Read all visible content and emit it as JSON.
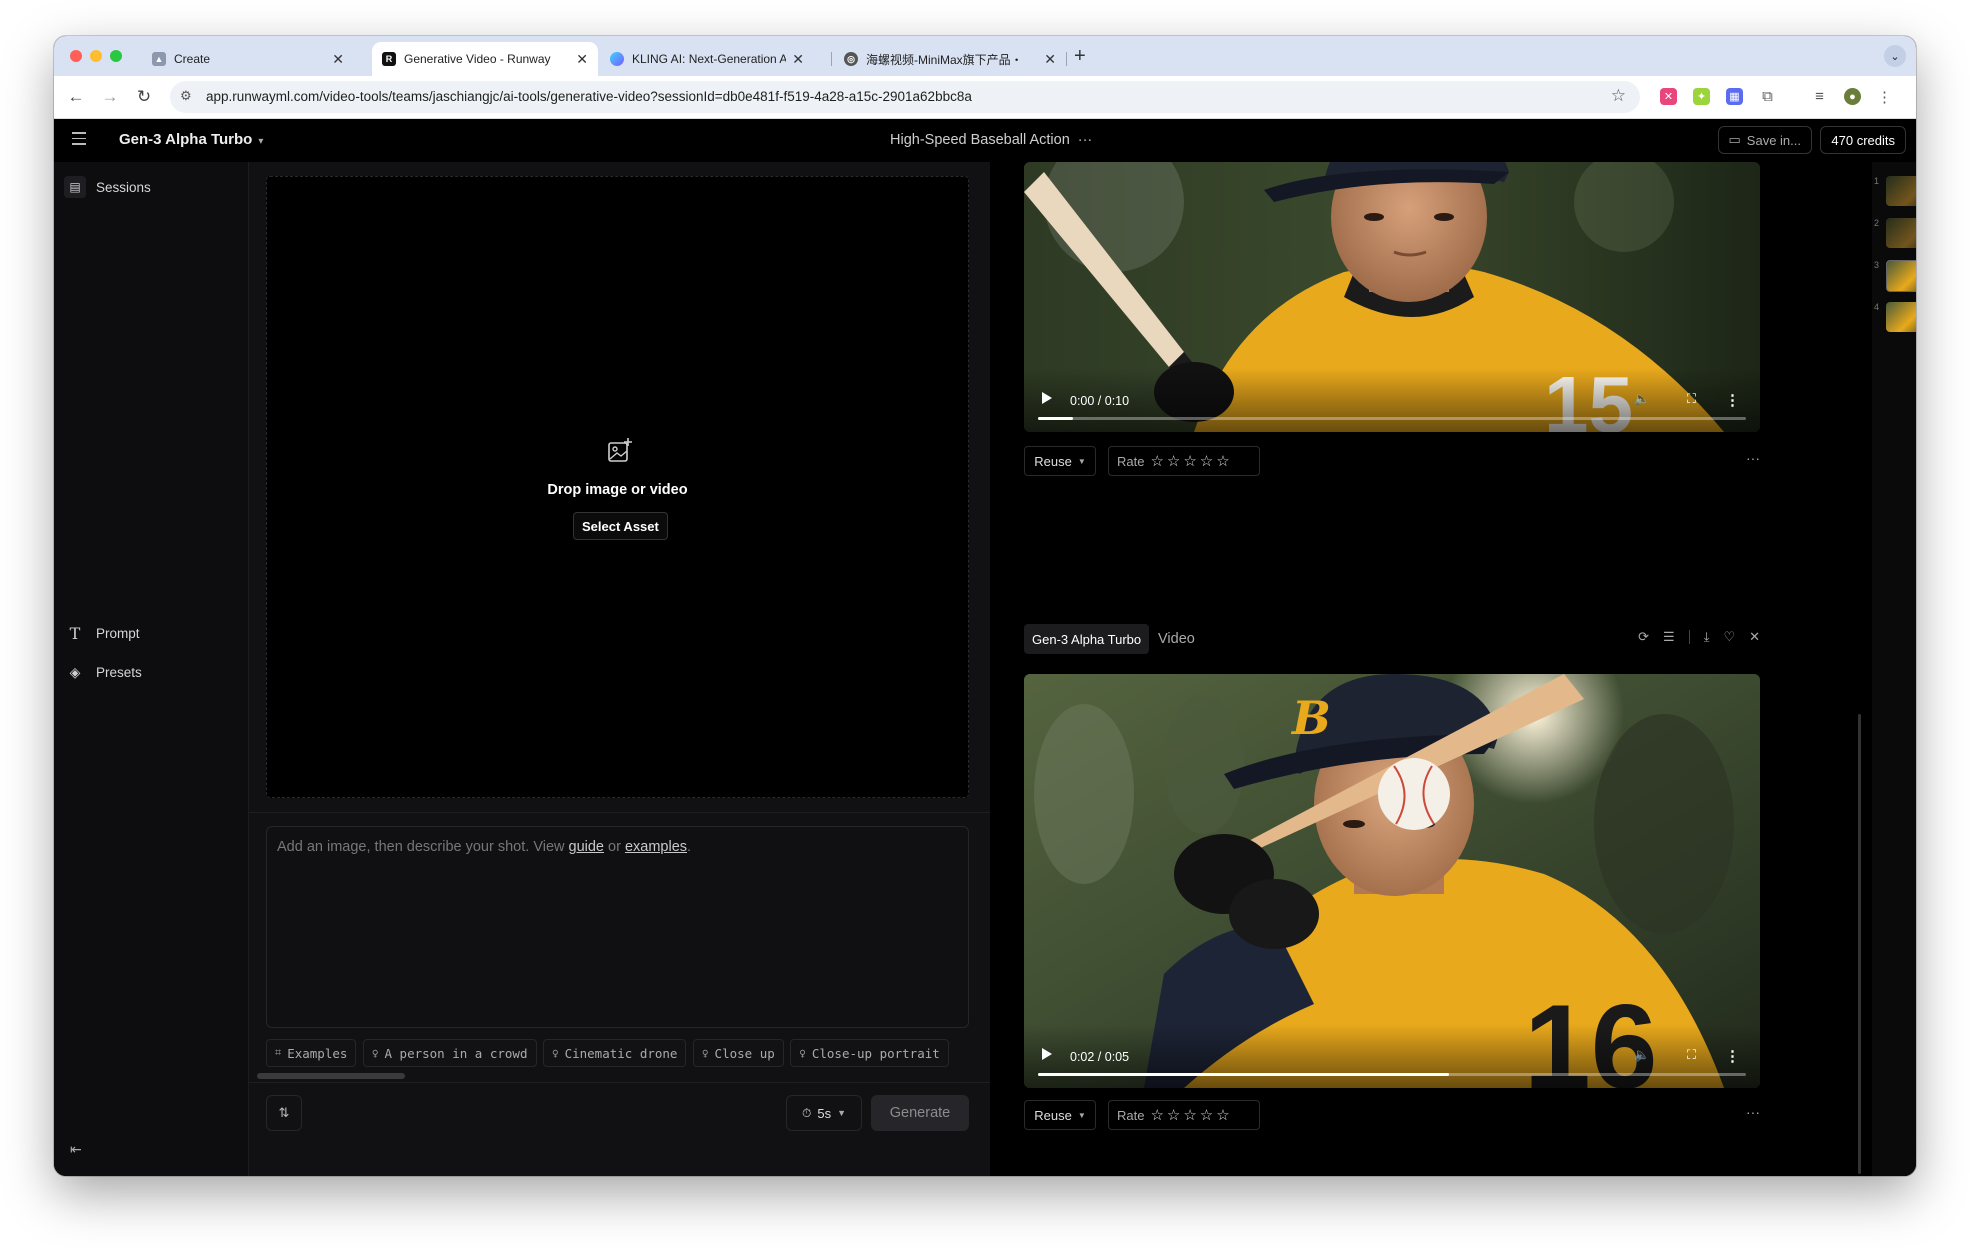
{
  "browser": {
    "tabs": [
      {
        "title": "Create",
        "active": false
      },
      {
        "title": "Generative Video - Runway",
        "active": true
      },
      {
        "title": "KLING AI: Next-Generation AI",
        "active": false
      },
      {
        "title": "海螺视频-MiniMax旗下产品・",
        "active": false
      }
    ],
    "new_tab_label": "+",
    "url": "app.runwayml.com/video-tools/teams/jaschiangjc/ai-tools/generative-video?sessionId=db0e481f-f519-4a28-a15c-2901a62bbc8a"
  },
  "header": {
    "model_name": "Gen-3 Alpha Turbo",
    "session_title": "High-Speed Baseball Action",
    "save_label": "Save in...",
    "credits_label": "470 credits"
  },
  "sidebar": {
    "sessions_label": "Sessions",
    "prompt_label": "Prompt",
    "presets_label": "Presets"
  },
  "editor": {
    "drop_text": "Drop image or video",
    "select_asset_label": "Select Asset",
    "prompt_placeholder_pre": "Add an image, then describe your shot. View ",
    "guide_link": "guide",
    "prompt_placeholder_mid": " or ",
    "examples_link": "examples",
    "prompt_placeholder_end": ".",
    "chips": [
      "Examples",
      "A person in a crowd",
      "Cinematic drone",
      "Close up",
      "Close-up portrait"
    ],
    "duration_label": "5s",
    "generate_label": "Generate"
  },
  "outputs": {
    "first_video": {
      "time": "0:00 / 0:10",
      "progress": 0.05
    },
    "second_video": {
      "time": "0:02 / 0:05",
      "progress": 0.58
    },
    "reuse_label": "Reuse",
    "rate_label": "Rate",
    "stars": "☆☆☆☆☆",
    "generation_model": "Gen-3 Alpha Turbo",
    "generation_type": "Video",
    "more_label": "···"
  },
  "thumbnails": [
    "1",
    "2",
    "3",
    "4"
  ],
  "colors": {
    "background": "#000000",
    "panel": "#111113",
    "jersey": "#e8a91c"
  }
}
